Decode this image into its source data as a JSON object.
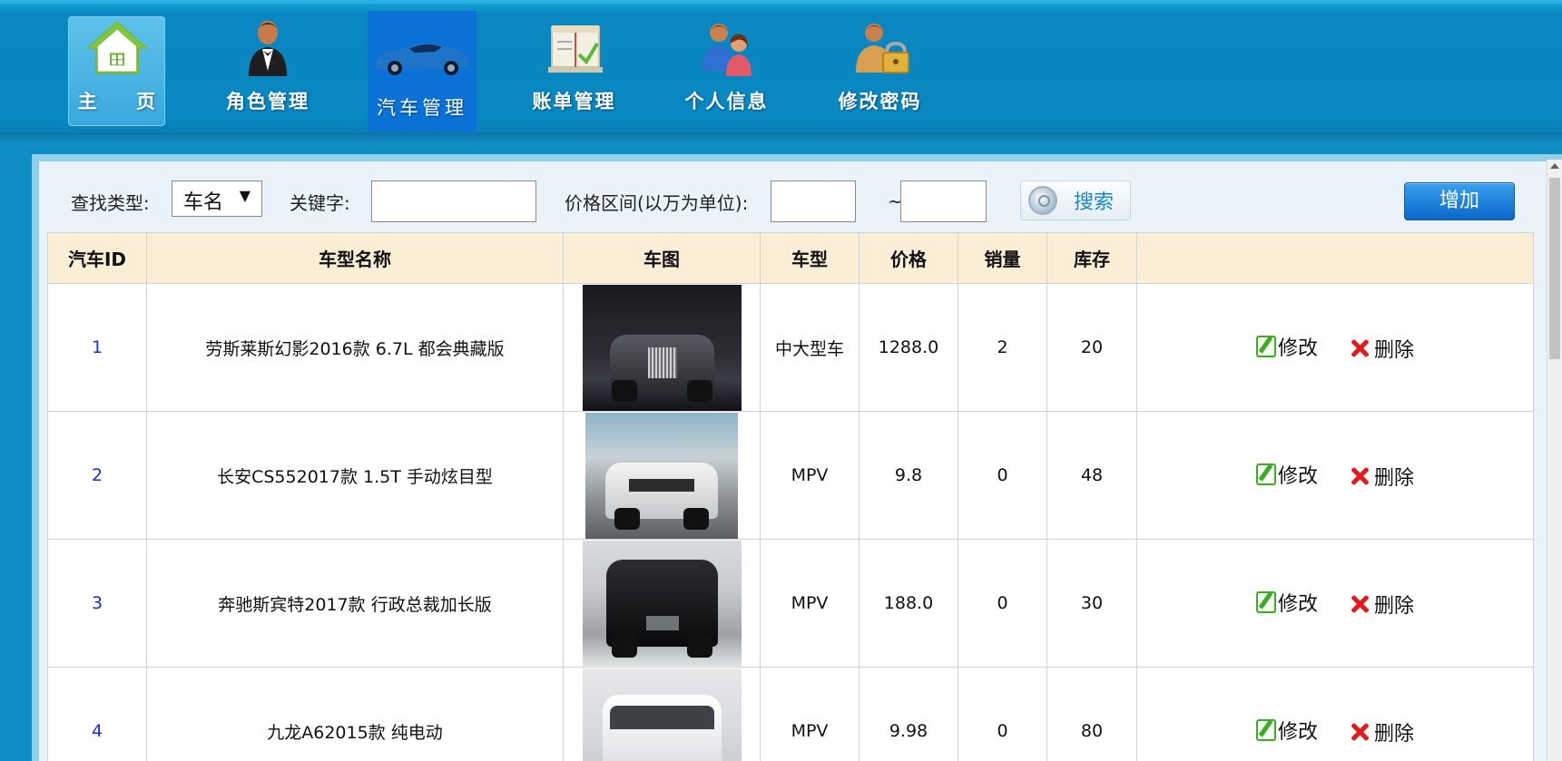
{
  "nav": {
    "items": [
      {
        "label": "主 页",
        "icon": "home-icon"
      },
      {
        "label": "角色管理",
        "icon": "butler-person-icon"
      },
      {
        "label": "汽车管理",
        "icon": "car-icon"
      },
      {
        "label": "账单管理",
        "icon": "ledger-icon"
      },
      {
        "label": "个人信息",
        "icon": "users-icon"
      },
      {
        "label": "修改密码",
        "icon": "person-lock-icon"
      }
    ],
    "active_index": 2
  },
  "search": {
    "type_label": "查找类型:",
    "type_value": "车名",
    "keyword_label": "关键字:",
    "keyword_value": "",
    "price_label": "价格区间(以万为单位):",
    "price_min": "",
    "price_separator": "~",
    "price_max": "",
    "search_button": "搜索",
    "add_button": "增加"
  },
  "table": {
    "columns": [
      "汽车ID",
      "车型名称",
      "车图",
      "车型",
      "价格",
      "销量",
      "库存",
      ""
    ],
    "rows": [
      {
        "id": "1",
        "name": "劳斯莱斯幻影2016款 6.7L 都会典藏版",
        "type": "中大型车",
        "price": "1288.0",
        "sales": "2",
        "stock": "20",
        "edit": "修改",
        "delete": "删除"
      },
      {
        "id": "2",
        "name": "长安CS552017款 1.5T 手动炫目型",
        "type": "MPV",
        "price": "9.8",
        "sales": "0",
        "stock": "48",
        "edit": "修改",
        "delete": "删除"
      },
      {
        "id": "3",
        "name": "奔驰斯宾特2017款 行政总裁加长版",
        "type": "MPV",
        "price": "188.0",
        "sales": "0",
        "stock": "30",
        "edit": "修改",
        "delete": "删除"
      },
      {
        "id": "4",
        "name": "九龙A62015款 纯电动",
        "type": "MPV",
        "price": "9.98",
        "sales": "0",
        "stock": "80",
        "edit": "修改",
        "delete": "删除"
      }
    ]
  },
  "colors": {
    "nav_background": "#0887c1",
    "nav_active": "#0a72d6",
    "table_header": "#fbeed6",
    "id_link": "#1a2fd6",
    "add_button": "#0a68c8"
  }
}
